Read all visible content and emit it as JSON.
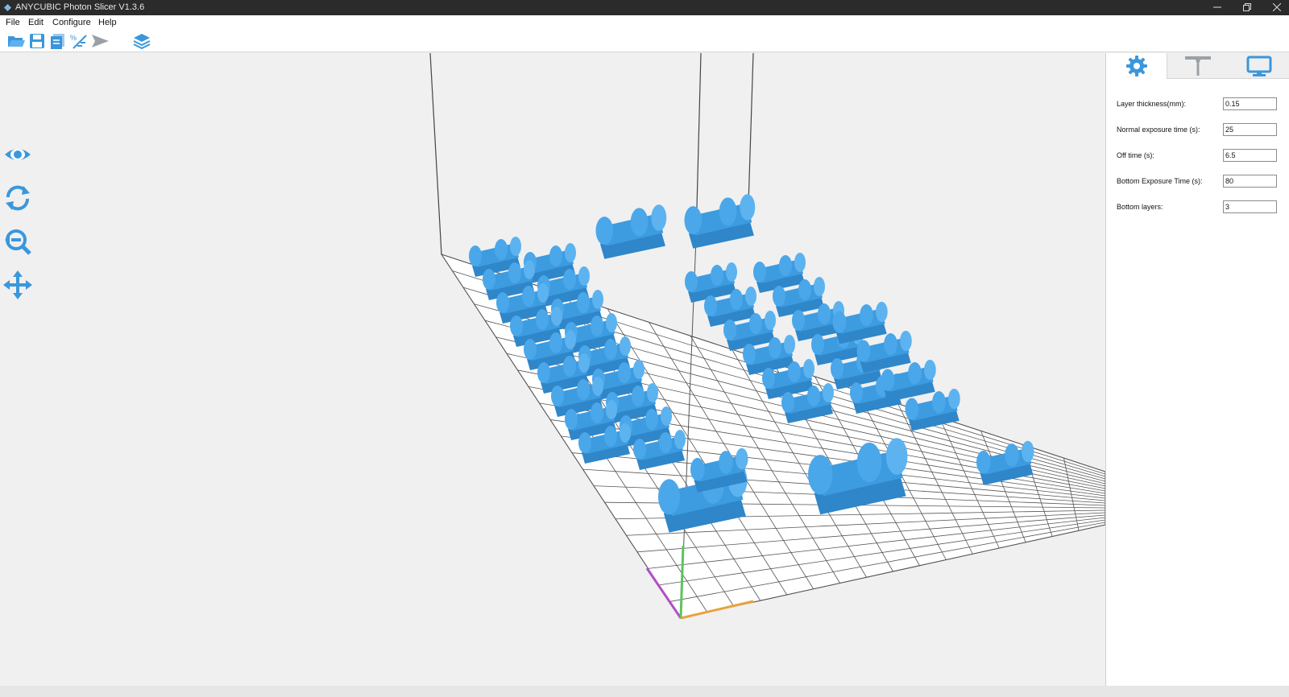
{
  "window": {
    "title": "ANYCUBIC Photon Slicer V1.3.6",
    "controls": [
      "minimize-icon",
      "restore-icon",
      "close-icon"
    ]
  },
  "menu": {
    "file": "File",
    "edit": "Edit",
    "configure": "Configure",
    "help": "Help"
  },
  "toolbar": {
    "icons": [
      "open-folder-icon",
      "save-icon",
      "copy-icon",
      "scale-icon",
      "send-icon",
      "layers-icon"
    ]
  },
  "view_tools": {
    "icons": [
      "eye-icon",
      "rotate-icon",
      "zoom-out-icon",
      "move-icon"
    ]
  },
  "panel": {
    "tabs": [
      "gear-icon",
      "support-icon",
      "monitor-icon"
    ],
    "active_tab": "gear-icon",
    "fields": {
      "layer_thickness": {
        "label": "Layer thickness(mm):",
        "value": "0.15"
      },
      "normal_exposure": {
        "label": "Normal exposure time (s):",
        "value": "25"
      },
      "off_time": {
        "label": "Off time (s):",
        "value": "6.5"
      },
      "bottom_exposure": {
        "label": "Bottom Exposure Time (s):",
        "value": "80"
      },
      "bottom_layers": {
        "label": "Bottom layers:",
        "value": "3"
      }
    }
  },
  "colors": {
    "accent": "#3a97dc",
    "model": "#3d9be0",
    "titlebar": "#2b2b2b",
    "axis_x": "#e8a33c",
    "axis_y": "#b14fc7",
    "axis_z": "#5cc45c"
  }
}
